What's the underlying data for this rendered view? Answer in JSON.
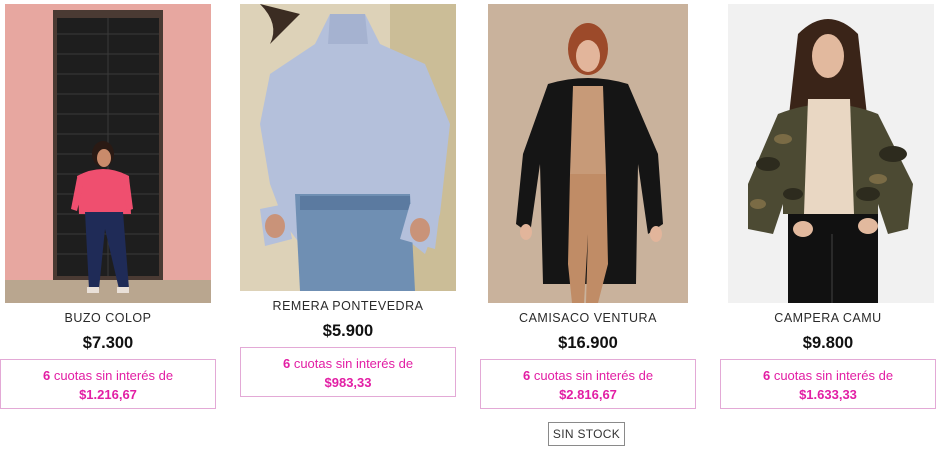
{
  "products": [
    {
      "name": "BUZO COLOP",
      "price": "$7.300",
      "installments_count": "6",
      "installments_text": "cuotas sin interés de",
      "installment_amount": "$1.216,67"
    },
    {
      "name": "REMERA PONTEVEDRA",
      "price": "$5.900",
      "installments_count": "6",
      "installments_text": "cuotas sin interés de",
      "installment_amount": "$983,33"
    },
    {
      "name": "CAMISACO VENTURA",
      "price": "$16.900",
      "installments_count": "6",
      "installments_text": "cuotas sin interés de",
      "installment_amount": "$2.816,67",
      "stock_label": "SIN STOCK"
    },
    {
      "name": "CAMPERA CAMU",
      "price": "$9.800",
      "installments_count": "6",
      "installments_text": "cuotas sin interés de",
      "installment_amount": "$1.633,33"
    }
  ],
  "colors": {
    "accent": "#e21ea4",
    "installments_border": "#e3a9d6"
  }
}
